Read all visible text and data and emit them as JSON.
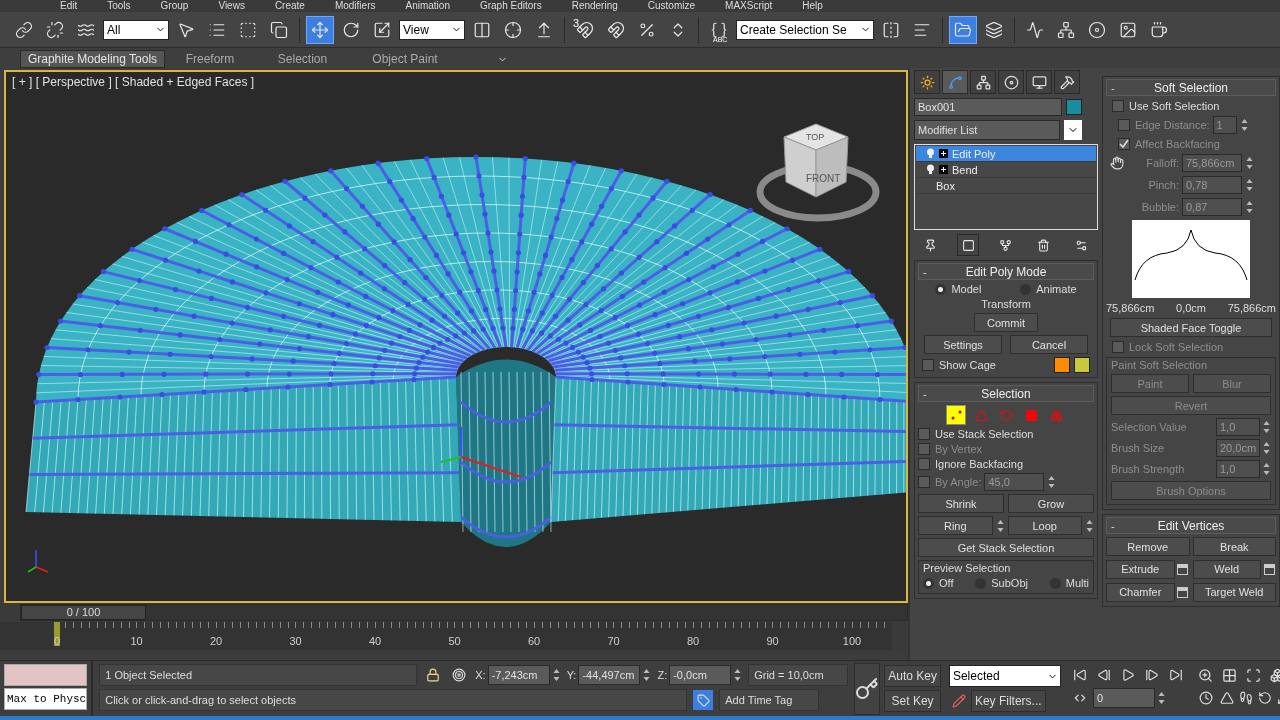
{
  "menu": [
    "Edit",
    "Tools",
    "Group",
    "Views",
    "Create",
    "Modifiers",
    "Animation",
    "Graph Editors",
    "Rendering",
    "Customize",
    "MAXScript",
    "Help"
  ],
  "toolbar": {
    "selection_filter": "All",
    "reference_coordinate": "View",
    "snap_label": "3",
    "named_selection_label": "ABC",
    "named_selection": "Create Selection Se",
    "tools": [
      {
        "selected": false
      },
      {
        "selected": false
      },
      {
        "selected": false
      },
      {
        "selected": false
      },
      {
        "selected": false
      },
      {
        "selected": false
      },
      {
        "selected": false
      },
      {
        "selected": true
      },
      {
        "selected": false
      },
      {
        "selected": false
      },
      {
        "selected": false
      },
      {
        "selected": false
      },
      {
        "selected": false
      },
      {
        "selected": false
      },
      {
        "selected": false
      },
      {
        "selected": false
      },
      {
        "selected": false
      },
      {
        "selected": false
      },
      {
        "selected": false
      },
      {
        "selected": false
      },
      {
        "selected": true
      },
      {
        "selected": false
      },
      {
        "selected": false
      },
      {
        "selected": false
      },
      {
        "selected": false
      },
      {
        "selected": false
      },
      {
        "selected": false
      }
    ]
  },
  "ribbon": {
    "tabs": [
      {
        "label": "Graphite Modeling Tools",
        "selected": true
      },
      {
        "label": "Freeform",
        "selected": false
      },
      {
        "label": "Selection",
        "selected": false
      },
      {
        "label": "Object Paint",
        "selected": false
      }
    ]
  },
  "viewport": {
    "label": "[ + ] [ Perspective ] [ Shaded + Edged Faces ]",
    "viewcube": {
      "top": "TOP",
      "front": "FRONT"
    }
  },
  "timeline": {
    "frame": "0 / 100",
    "level": 0,
    "ticks": [
      "0",
      "10",
      "20",
      "30",
      "40",
      "50",
      "60",
      "70",
      "80",
      "90",
      "100"
    ]
  },
  "command_panel": {
    "tabs": [
      {
        "selected": false
      },
      {
        "selected": true
      },
      {
        "selected": false
      },
      {
        "selected": false
      },
      {
        "selected": false
      },
      {
        "selected": false
      }
    ],
    "object_name": "Box001",
    "modifier_list": "Modifier List",
    "stack": [
      {
        "label": "Edit Poly",
        "kind": "modifier",
        "selected": true
      },
      {
        "label": "Bend",
        "kind": "modifier",
        "selected": false
      },
      {
        "label": "Box",
        "kind": "base",
        "selected": false
      }
    ],
    "stack_tools": [
      {
        "selected": false
      },
      {
        "selected": true
      },
      {
        "selected": false
      },
      {
        "selected": false
      },
      {
        "selected": false
      }
    ],
    "edit_poly_mode": {
      "toggle": "-",
      "title": "Edit Poly Mode",
      "modes": [
        {
          "label": "Model",
          "selected": true
        },
        {
          "label": "Animate",
          "selected": false
        }
      ],
      "transform": "Transform",
      "commit": "Commit",
      "settings": "Settings",
      "cancel": "Cancel",
      "show_cage": {
        "label": "Show Cage",
        "checked": false
      },
      "cage_colors": [
        {
          "color": "#ff8c00"
        },
        {
          "color": "#c8c83c"
        }
      ]
    },
    "selection": {
      "toggle": "-",
      "title": "Selection",
      "levels": [
        {
          "selected": true
        },
        {
          "selected": false
        },
        {
          "selected": false
        },
        {
          "selected": false
        },
        {
          "selected": false
        }
      ],
      "options": [
        {
          "label": "Use Stack Selection",
          "checked": false,
          "disabled": false
        },
        {
          "label": "By Vertex",
          "checked": false,
          "disabled": true
        },
        {
          "label": "Ignore Backfacing",
          "checked": false,
          "disabled": false
        },
        {
          "label": "By Angle:",
          "checked": false,
          "disabled": true,
          "value": "45,0"
        }
      ],
      "shrink": "Shrink",
      "grow": "Grow",
      "ring": "Ring",
      "loop": "Loop",
      "get_stack_selection": "Get Stack Selection",
      "preview": {
        "title": "Preview Selection",
        "options": [
          {
            "label": "Off",
            "selected": true
          },
          {
            "label": "SubObj",
            "selected": false
          },
          {
            "label": "Multi",
            "selected": false
          }
        ]
      }
    },
    "soft_selection": {
      "toggle": "-",
      "title": "Soft Selection",
      "use_soft_selection": {
        "label": "Use Soft Selection",
        "checked": false
      },
      "edge_distance": {
        "label": "Edge Distance:",
        "checked": false,
        "value": "1"
      },
      "affect_backfacing": {
        "label": "Affect Backfacing",
        "checked": true
      },
      "fields": [
        {
          "label": "Falloff:",
          "value": "75,866cm"
        },
        {
          "label": "Pinch:",
          "value": "0,78"
        },
        {
          "label": "Bubble:",
          "value": "0,87"
        }
      ],
      "curve_labels": [
        "75,866cm",
        "0,0cm",
        "75,866cm"
      ],
      "shaded_face_toggle": "Shaded Face Toggle",
      "lock": {
        "label": "Lock Soft Selection",
        "checked": false
      },
      "paint": {
        "title": "Paint Soft Selection",
        "paint": "Paint",
        "blur": "Blur",
        "revert": "Revert",
        "fields": [
          {
            "label": "Selection Value",
            "value": "1,0"
          },
          {
            "label": "Brush Size",
            "value": "20,0cm"
          },
          {
            "label": "Brush Strength",
            "value": "1,0"
          }
        ],
        "brush_options": "Brush Options"
      }
    },
    "edit_vertices": {
      "toggle": "-",
      "title": "Edit Vertices",
      "buttons": [
        {
          "label": "Remove",
          "kind": "plain"
        },
        {
          "label": "Break",
          "kind": "plain"
        },
        {
          "label": "Extrude",
          "kind": "settings"
        },
        {
          "label": "Weld",
          "kind": "settings"
        },
        {
          "label": "Chamfer",
          "kind": "settings"
        },
        {
          "label": "Target Weld",
          "kind": "plain"
        }
      ]
    }
  },
  "status_bar": {
    "script": "Max to Physc",
    "selection_info": "1 Object Selected",
    "prompt": "Click or click-and-drag to select objects",
    "coords": [
      {
        "axis": "X:",
        "value": "-7,243cm"
      },
      {
        "axis": "Y:",
        "value": "-44,497cm"
      },
      {
        "axis": "Z:",
        "value": "-0,0cm"
      }
    ],
    "grid": "Grid = 10,0cm",
    "add_time_tag": "Add Time Tag",
    "auto_key": "Auto Key",
    "set_key": "Set Key",
    "key_mode": "Selected",
    "key_filters": "Key Filters...",
    "current_frame": "0"
  }
}
